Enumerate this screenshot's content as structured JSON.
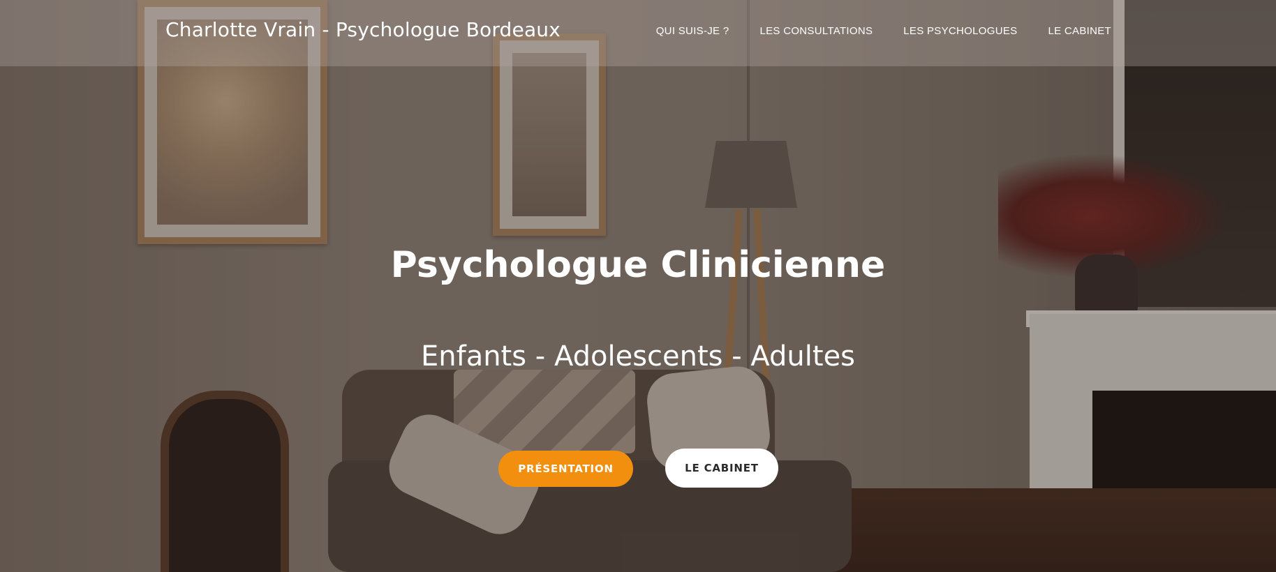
{
  "header": {
    "brand": "Charlotte Vrain - Psychologue Bordeaux",
    "nav": [
      {
        "label": "QUI SUIS-JE ?"
      },
      {
        "label": "LES CONSULTATIONS"
      },
      {
        "label": "LES PSYCHOLOGUES"
      },
      {
        "label": "LE CABINET"
      }
    ]
  },
  "hero": {
    "title": "Psychologue Clinicienne",
    "subtitle": "Enfants - Adolescents - Adultes",
    "primary_button": "PRÉSENTATION",
    "secondary_button": "LE CABINET"
  },
  "colors": {
    "accent": "#f28f0e",
    "button_light": "#ffffff",
    "text": "#ffffff"
  }
}
